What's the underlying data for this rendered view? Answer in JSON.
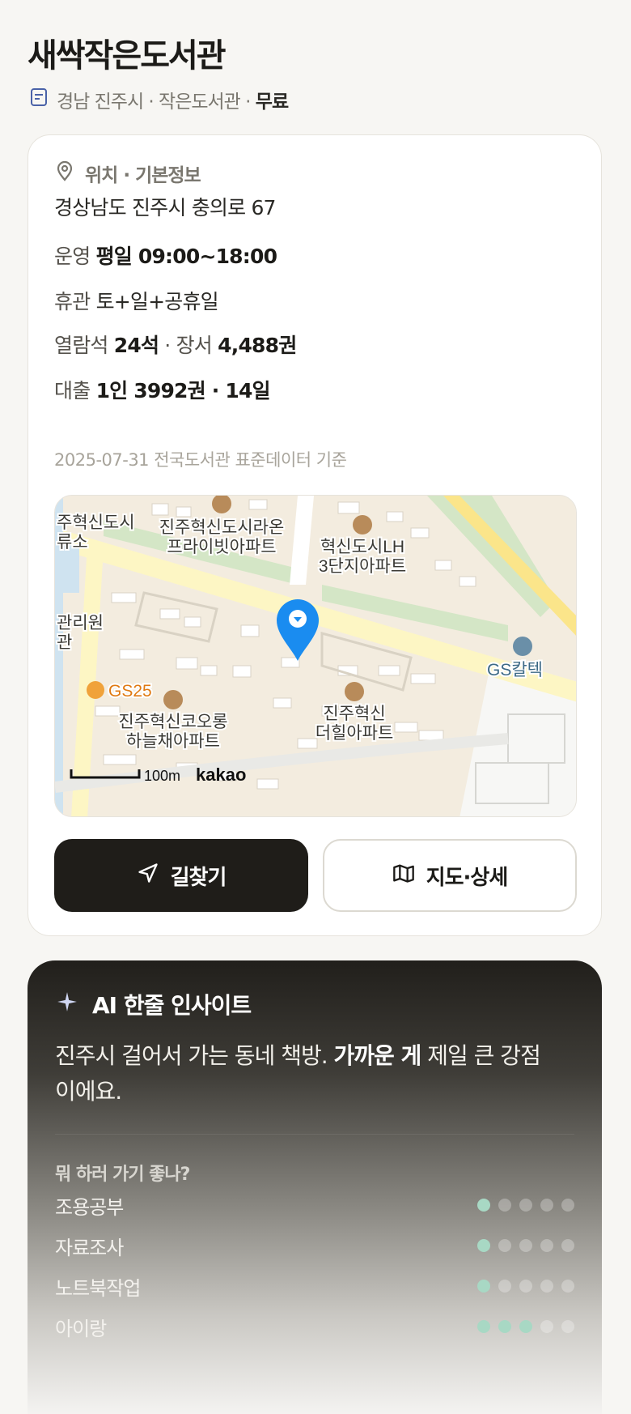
{
  "title": "새싹작은도서관",
  "subline": {
    "region": "경남 진주시 · 작은도서관 · ",
    "fee": "무료"
  },
  "info": {
    "section_title": "위치 · 기본정보",
    "address": "경상남도 진주시 충의로 67",
    "hours_label": "운영",
    "hours_value": "평일 09:00~18:00",
    "closed_label": "휴관",
    "closed_value": "토+일+공휴일",
    "seats_label": "열람석",
    "seats_value": "24석",
    "books_sep": " · 장서 ",
    "books_value": "4,488권",
    "loan_label": "대출",
    "loan_value": "1인 3992권 · 14일",
    "source": "2025-07-31 전국도서관 표준데이터 기준"
  },
  "map": {
    "labels": {
      "apt_raon": "진주혁신도시라온",
      "apt_raon2": "프라이빗아파트",
      "apt_lh": "혁신도시LH",
      "apt_lh2": "3단지아파트",
      "edge_top": "주혁신도시",
      "edge_top2": "류소",
      "edge_mid": "관리원",
      "edge_mid2": "관",
      "gs25": "GS25",
      "kolon": "진주혁신코오롱",
      "kolon2": "하늘채아파트",
      "hill": "진주혁신",
      "hill2": "더힐아파트",
      "gs_caltex": "GS칼텍",
      "scale": "100m",
      "brand": "kakao"
    }
  },
  "buttons": {
    "directions": "길찾기",
    "map_detail": "지도·상세"
  },
  "ai": {
    "title": "AI 한줄 인사이트",
    "text_before": "진주시 걸어서 가는 동네 책방. ",
    "text_bold": "가까운 게",
    "text_after": " 제일 큰 강점이에요.",
    "question": "뭐 하러 가기 좋나?",
    "activities": [
      {
        "name": "조용공부",
        "rating": 1,
        "max": 5
      },
      {
        "name": "자료조사",
        "rating": 1,
        "max": 5
      },
      {
        "name": "노트북작업",
        "rating": 1,
        "max": 5
      },
      {
        "name": "아이랑",
        "rating": 3,
        "max": 5
      }
    ]
  },
  "colors": {
    "accent_dark": "#1f1d19",
    "rating_on": "#a8d8c4",
    "pin": "#1a8cf0"
  }
}
